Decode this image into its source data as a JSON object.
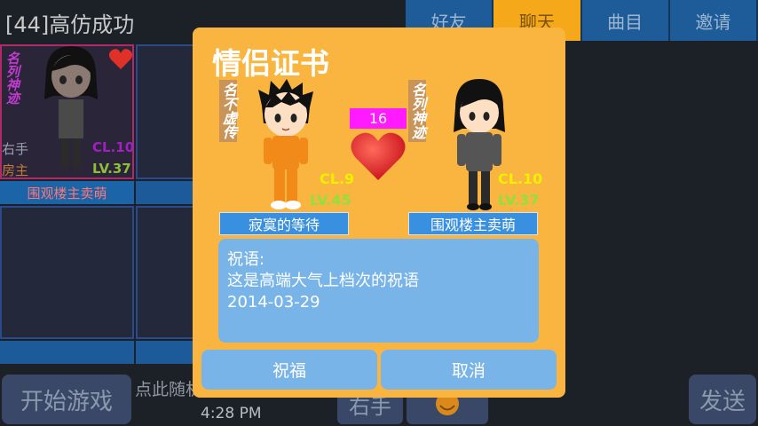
{
  "room": {
    "title": "[44]高仿成功"
  },
  "tabs": [
    {
      "label": "好友",
      "active": false
    },
    {
      "label": "聊天",
      "active": true
    },
    {
      "label": "曲目",
      "active": false
    },
    {
      "label": "邀请",
      "active": false
    }
  ],
  "background_player": {
    "vertical_name": "名列神迹",
    "role": "右手",
    "host": "房主",
    "cl": "CL.10",
    "lv": "LV.37",
    "name": "围观楼主卖萌"
  },
  "bottom": {
    "start_label": "开始游戏",
    "chat_hint": "点此随机",
    "clock": "4:28 PM",
    "role_label": "右手",
    "send_label": "发送"
  },
  "dialog": {
    "title": "情侣证书",
    "score": "16",
    "left": {
      "vertical_name": "名不虚传",
      "cl": "CL.9",
      "lv": "LV.45",
      "name": "寂寞的等待"
    },
    "right": {
      "vertical_name": "名列神迹",
      "cl": "CL.10",
      "lv": "LV.37",
      "name": "围观楼主卖萌"
    },
    "wish_label": "祝语:",
    "wish_text": "这是高端大气上档次的祝语",
    "wish_date": "2014-03-29",
    "bless_label": "祝福",
    "cancel_label": "取消"
  },
  "colors": {
    "dialog_bg": "#f9b540",
    "active_tab": "#f5a81a",
    "tab_bg": "#1d5c98",
    "wish_bg": "#78b4e8",
    "score_bg": "#ff1aff"
  }
}
